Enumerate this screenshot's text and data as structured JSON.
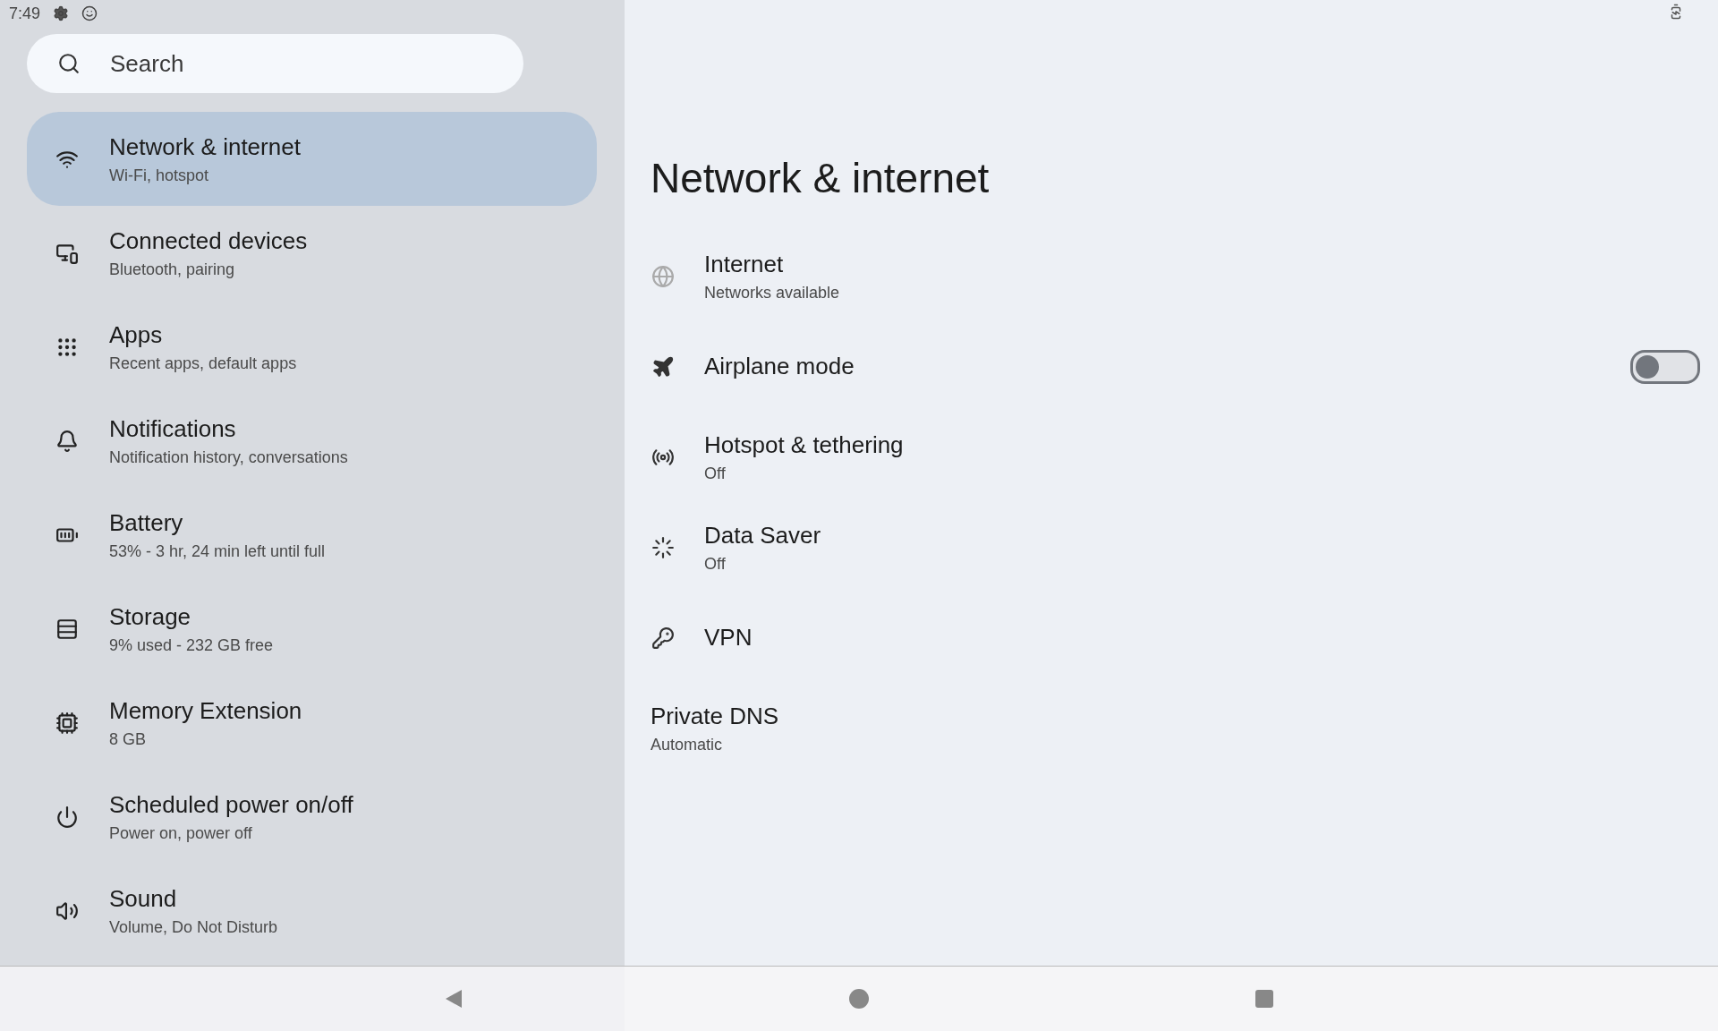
{
  "status_bar": {
    "time": "7:49"
  },
  "search": {
    "placeholder": "Search"
  },
  "sidebar": {
    "items": [
      {
        "title": "Network & internet",
        "subtitle": "Wi-Fi, hotspot",
        "selected": true
      },
      {
        "title": "Connected devices",
        "subtitle": "Bluetooth, pairing",
        "selected": false
      },
      {
        "title": "Apps",
        "subtitle": "Recent apps, default apps",
        "selected": false
      },
      {
        "title": "Notifications",
        "subtitle": "Notification history, conversations",
        "selected": false
      },
      {
        "title": "Battery",
        "subtitle": "53% - 3 hr, 24 min left until full",
        "selected": false
      },
      {
        "title": "Storage",
        "subtitle": "9% used - 232 GB free",
        "selected": false
      },
      {
        "title": "Memory Extension",
        "subtitle": "8 GB",
        "selected": false
      },
      {
        "title": "Scheduled power on/off",
        "subtitle": "Power on, power off",
        "selected": false
      },
      {
        "title": "Sound",
        "subtitle": "Volume, Do Not Disturb",
        "selected": false
      }
    ]
  },
  "page": {
    "title": "Network & internet",
    "rows": [
      {
        "kind": "link",
        "title": "Internet",
        "subtitle": "Networks available"
      },
      {
        "kind": "toggle",
        "title": "Airplane mode",
        "on": false
      },
      {
        "kind": "link",
        "title": "Hotspot & tethering",
        "subtitle": "Off"
      },
      {
        "kind": "link",
        "title": "Data Saver",
        "subtitle": "Off"
      },
      {
        "kind": "link",
        "title": "VPN"
      },
      {
        "kind": "text",
        "title": "Private DNS",
        "subtitle": "Automatic"
      }
    ]
  }
}
